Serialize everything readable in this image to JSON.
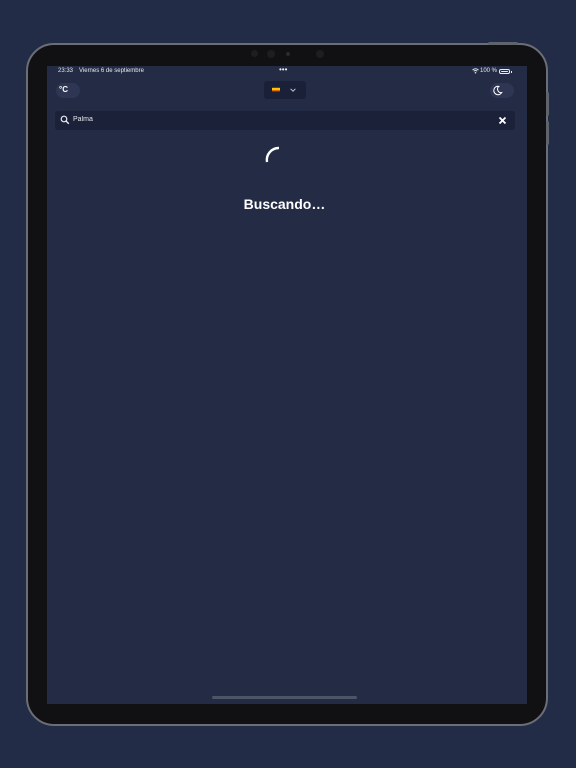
{
  "status_bar": {
    "time": "23:33",
    "date": "Viernes 6 de septiembre",
    "multitask_dots": "•••",
    "battery_text": "100 %",
    "wifi_icon": "wifi-icon",
    "battery_level": 1.0
  },
  "header": {
    "unit_toggle_label": "°C",
    "language_select": {
      "selected_flag_icon": "spain-flag-icon",
      "chevron_icon": "chevron-down-icon"
    },
    "theme_toggle_icon": "moon-icon"
  },
  "search": {
    "value": "Palma",
    "search_icon": "search-icon",
    "clear_icon": "close-icon"
  },
  "loading": {
    "text": "Buscando…",
    "spinner_icon": "spinner-icon"
  },
  "colors": {
    "background": "#232b45",
    "search_bg": "#1b2139",
    "text": "#ffffff"
  }
}
